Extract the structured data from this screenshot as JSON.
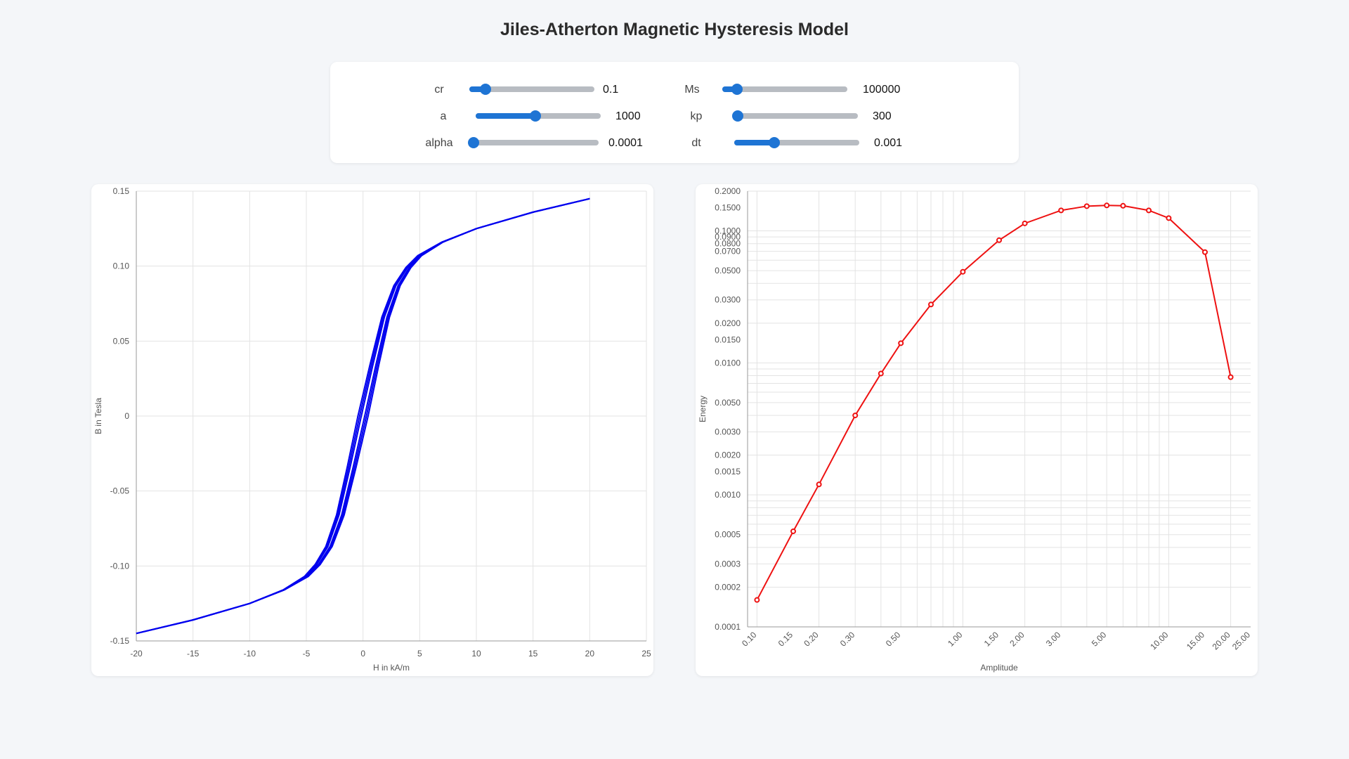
{
  "title": "Jiles-Atherton Magnetic Hysteresis Model",
  "controls": [
    {
      "label": "cr",
      "value": "0.1",
      "fraction": 0.13
    },
    {
      "label": "Ms",
      "value": "100000",
      "fraction": 0.12
    },
    {
      "label": "a",
      "value": "1000",
      "fraction": 0.48
    },
    {
      "label": "kp",
      "value": "300",
      "fraction": 0.04
    },
    {
      "label": "alpha",
      "value": "0.0001",
      "fraction": 0.0
    },
    {
      "label": "dt",
      "value": "0.001",
      "fraction": 0.32
    }
  ],
  "colors": {
    "accent": "#1e74d4",
    "loop": "#0000ee",
    "energy": "#ee1111"
  },
  "chart_data": [
    {
      "type": "line",
      "xlabel": "H in kA/m",
      "ylabel": "B in Tesla",
      "xlim": [
        -20,
        25
      ],
      "ylim": [
        -0.15,
        0.15
      ],
      "x_ticks": [
        "-20",
        "-15",
        "-10",
        "-5",
        "0",
        "5",
        "10",
        "15",
        "20",
        "25"
      ],
      "y_ticks": [
        "0.15",
        "0.10",
        "0.05",
        "0",
        "-0.05",
        "-0.10",
        "-0.15"
      ],
      "series": [
        {
          "x": [
            -20,
            -15,
            -10,
            -7,
            -5,
            -4,
            -3,
            -2,
            -1,
            0,
            1,
            2,
            3,
            4,
            5,
            7,
            10,
            15,
            20
          ],
          "y": [
            -0.145,
            -0.136,
            -0.125,
            -0.116,
            -0.107,
            -0.099,
            -0.087,
            -0.066,
            -0.034,
            0.0,
            0.034,
            0.066,
            0.087,
            0.099,
            0.107,
            0.116,
            0.125,
            0.136,
            0.145
          ]
        }
      ],
      "grid": true
    },
    {
      "type": "line",
      "xlabel": "Amplitude",
      "ylabel": "Energy",
      "x_scale": "log",
      "y_scale": "log",
      "xlim": [
        0.09,
        25
      ],
      "ylim": [
        0.0001,
        0.2
      ],
      "x_ticks": [
        "0.10",
        "0.15",
        "0.20",
        "0.30",
        "0.50",
        "1.00",
        "1.50",
        "2.00",
        "3.00",
        "5.00",
        "10.00",
        "15.00",
        "20.00",
        "25.00"
      ],
      "y_ticks": [
        "0.2000",
        "0.1500",
        "0.1000",
        "0.0900",
        "0.0800",
        "0.0700",
        "0.0500",
        "0.0300",
        "0.0200",
        "0.0150",
        "0.0100",
        "0.0050",
        "0.0030",
        "0.0020",
        "0.0015",
        "0.0010",
        "0.0005",
        "0.0003",
        "0.0002",
        "0.0001"
      ],
      "series": [
        {
          "x": [
            0.1,
            0.15,
            0.2,
            0.3,
            0.4,
            0.5,
            0.7,
            1.0,
            1.5,
            2.0,
            3.0,
            4.0,
            5.0,
            6.0,
            8.0,
            10.0,
            15.0,
            20.0
          ],
          "y": [
            0.00016,
            0.00053,
            0.0012,
            0.004,
            0.0083,
            0.0141,
            0.0277,
            0.049,
            0.085,
            0.114,
            0.143,
            0.154,
            0.156,
            0.155,
            0.143,
            0.125,
            0.069,
            0.0078
          ]
        }
      ],
      "grid": true
    }
  ]
}
